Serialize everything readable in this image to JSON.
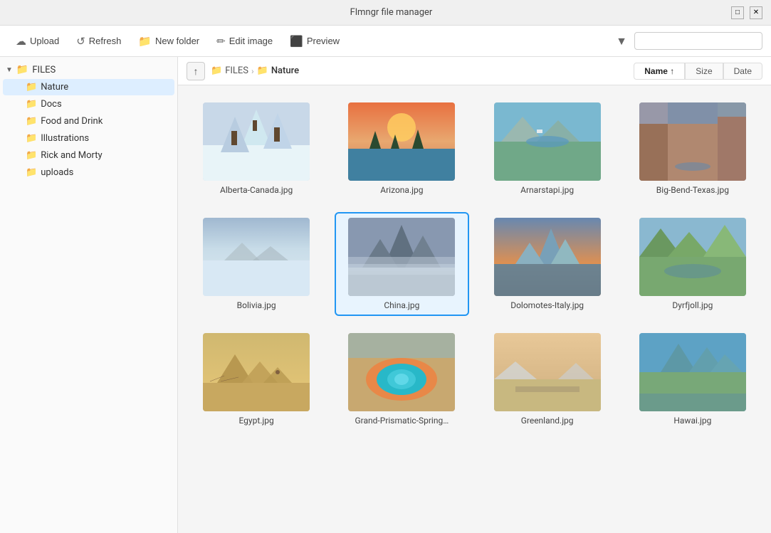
{
  "titlebar": {
    "title": "Flmngr file manager",
    "minimize_label": "□",
    "close_label": "✕"
  },
  "toolbar": {
    "upload_label": "Upload",
    "refresh_label": "Refresh",
    "new_folder_label": "New folder",
    "edit_image_label": "Edit image",
    "preview_label": "Preview",
    "search_placeholder": ""
  },
  "sidebar": {
    "root_label": "FILES",
    "items": [
      {
        "id": "nature",
        "label": "Nature",
        "active": true
      },
      {
        "id": "docs",
        "label": "Docs",
        "active": false
      },
      {
        "id": "food-and-drink",
        "label": "Food and Drink",
        "active": false
      },
      {
        "id": "illustrations",
        "label": "Illustrations",
        "active": false
      },
      {
        "id": "rick-and-morty",
        "label": "Rick and Morty",
        "active": false
      },
      {
        "id": "uploads",
        "label": "uploads",
        "active": false
      }
    ]
  },
  "nav": {
    "breadcrumb_root": "FILES",
    "breadcrumb_current": "Nature",
    "sort_name": "Name",
    "sort_size": "Size",
    "sort_date": "Date"
  },
  "files": [
    {
      "id": 1,
      "name": "Alberta-Canada.jpg",
      "selected": false,
      "color1": "#c8dde8",
      "color2": "#e8f4f8",
      "color3": "#a0b8c8",
      "type": "snowy-forest"
    },
    {
      "id": 2,
      "name": "Arizona.jpg",
      "selected": false,
      "color1": "#e8a070",
      "color2": "#c86030",
      "color3": "#6090a0",
      "type": "desert-sunset"
    },
    {
      "id": 3,
      "name": "Arnarstapi.jpg",
      "selected": false,
      "color1": "#78b090",
      "color2": "#90c8a8",
      "color3": "#6888a8",
      "type": "iceland"
    },
    {
      "id": 4,
      "name": "Big-Bend-Texas.jpg",
      "selected": false,
      "color1": "#b89878",
      "color2": "#907060",
      "color3": "#8090a8",
      "type": "canyon"
    },
    {
      "id": 5,
      "name": "Bolivia.jpg",
      "selected": false,
      "color1": "#b8ccd8",
      "color2": "#d8e8f0",
      "color3": "#8899aa",
      "type": "salt-flats"
    },
    {
      "id": 6,
      "name": "China.jpg",
      "selected": true,
      "color1": "#8898a8",
      "color2": "#c8d4dc",
      "color3": "#607080",
      "type": "mountains-mist"
    },
    {
      "id": 7,
      "name": "Dolomotes-Italy.jpg",
      "selected": false,
      "color1": "#e09050",
      "color2": "#c87030",
      "color3": "#6888a8",
      "type": "dolomites"
    },
    {
      "id": 8,
      "name": "Dyrfjoll.jpg",
      "selected": false,
      "color1": "#78a870",
      "color2": "#90c888",
      "color3": "#607858",
      "type": "green-valley"
    },
    {
      "id": 9,
      "name": "Egypt.jpg",
      "selected": false,
      "color1": "#c8a860",
      "color2": "#e8c878",
      "color3": "#806040",
      "type": "pyramids"
    },
    {
      "id": 10,
      "name": "Grand-Prismatic-Spring…",
      "selected": false,
      "color1": "#28b8c8",
      "color2": "#e89050",
      "color3": "#88c0b0",
      "type": "prismatic"
    },
    {
      "id": 11,
      "name": "Greenland.jpg",
      "selected": false,
      "color1": "#d8e0e8",
      "color2": "#b0c0d0",
      "color3": "#a09080",
      "type": "sled-dogs"
    },
    {
      "id": 12,
      "name": "Hawai.jpg",
      "selected": false,
      "color1": "#68b8c8",
      "color2": "#90c8a8",
      "color3": "#789068",
      "type": "hawaii"
    }
  ]
}
